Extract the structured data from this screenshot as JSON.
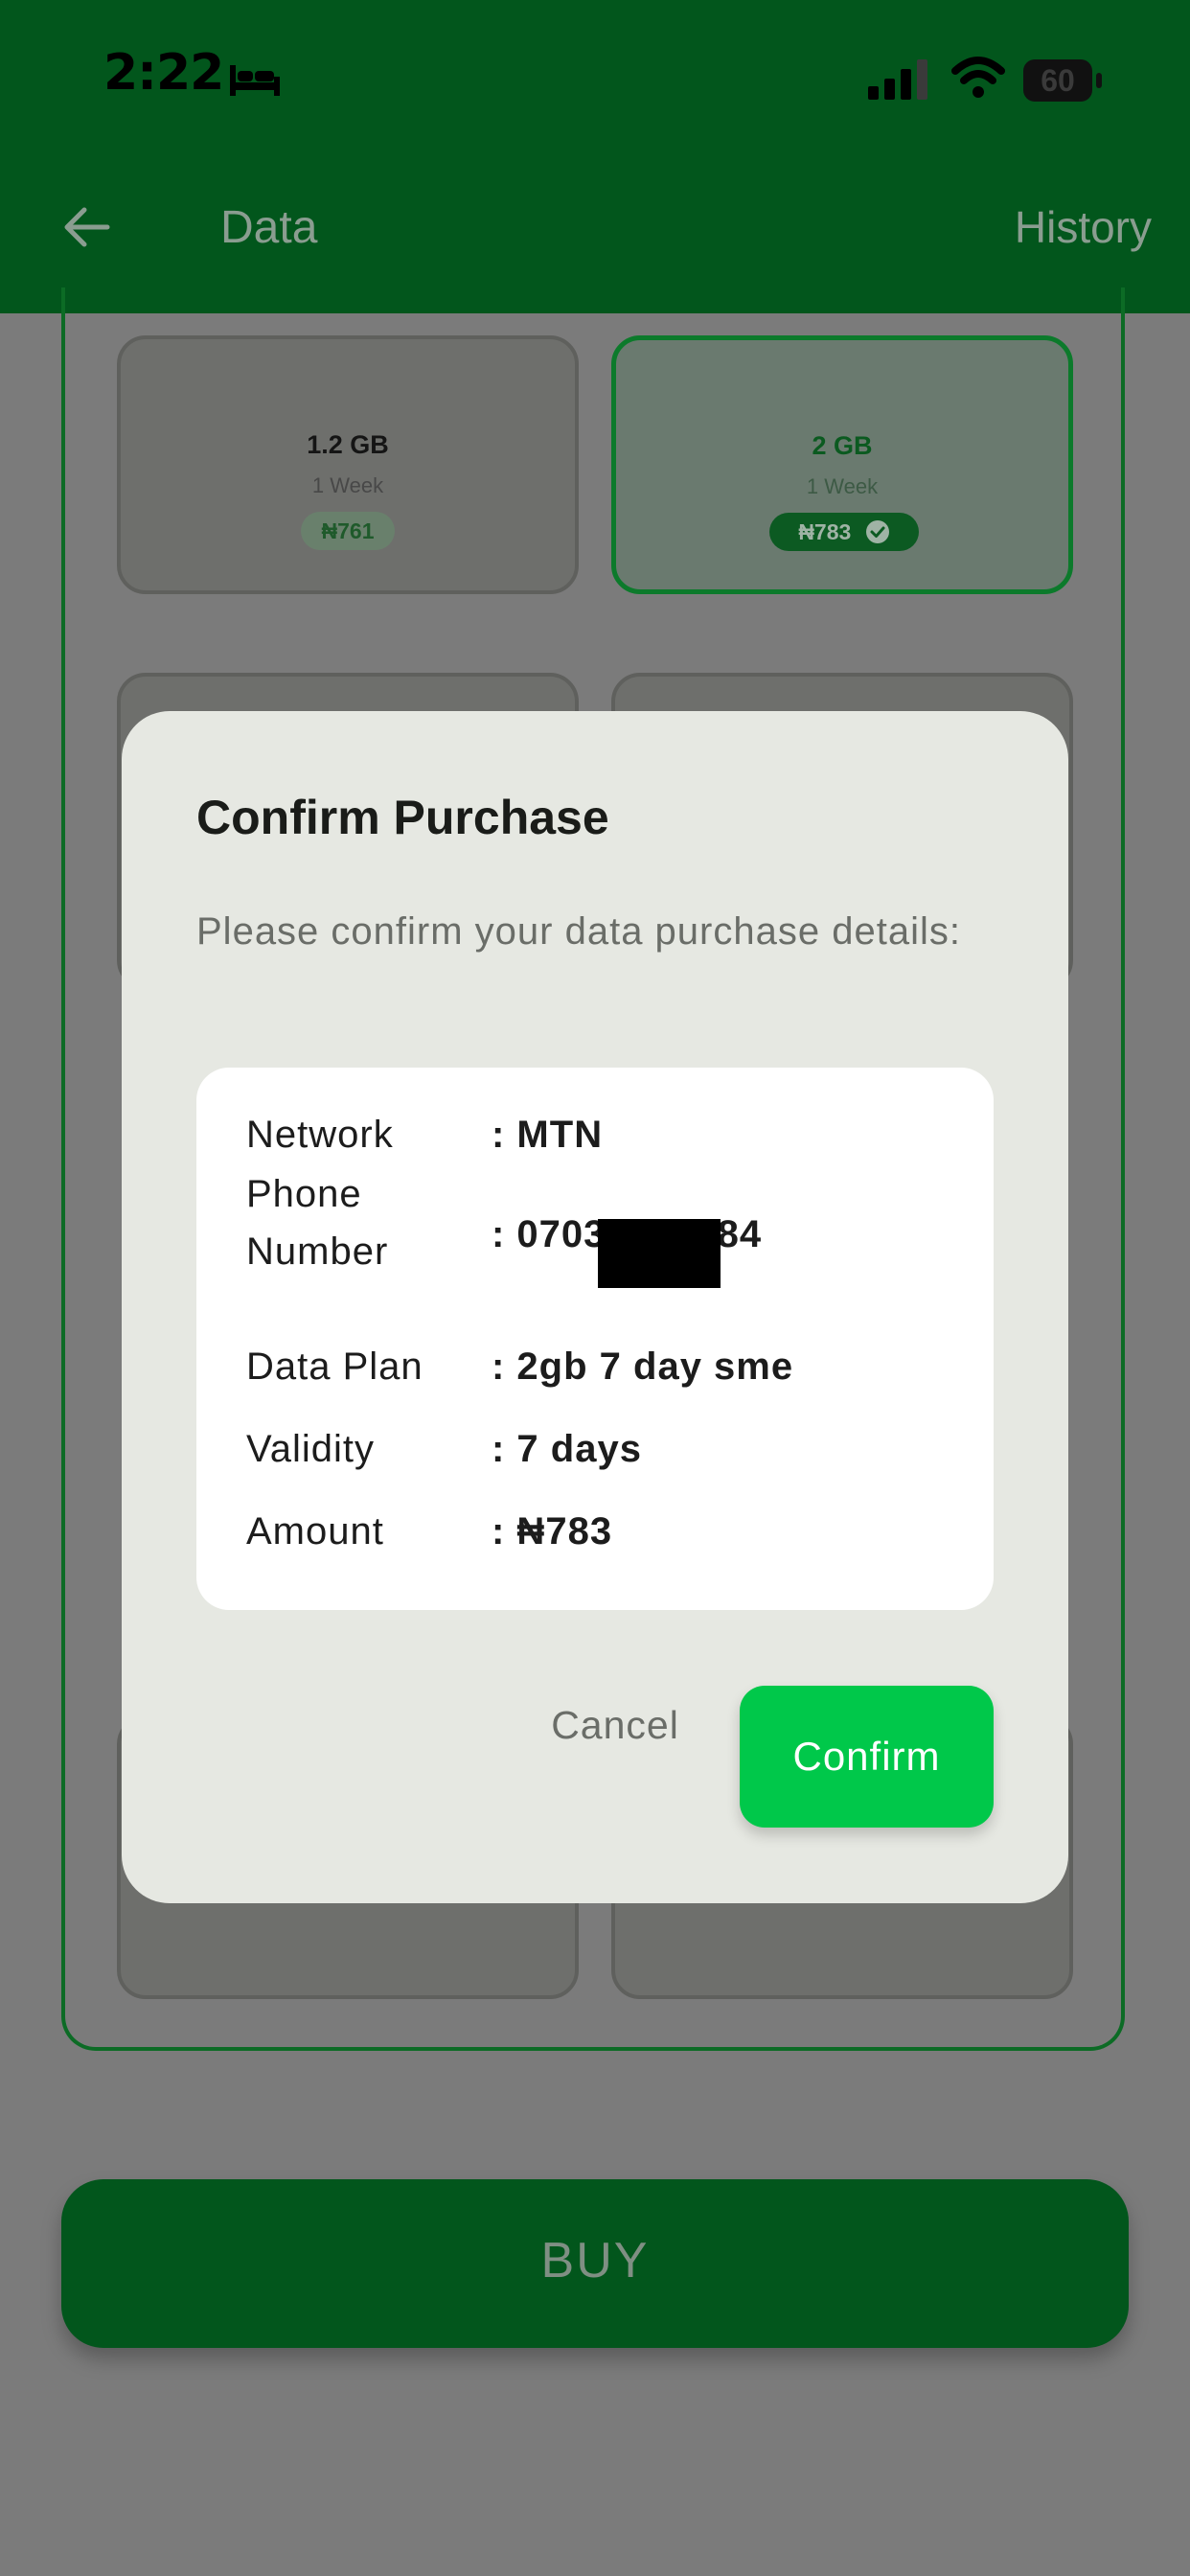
{
  "status_bar": {
    "time": "2:22",
    "battery": "60"
  },
  "header": {
    "title": "Data",
    "history_label": "History"
  },
  "plans": [
    {
      "size": "1.2 GB",
      "validity": "1 Week",
      "price": "₦761",
      "selected": false
    },
    {
      "size": "2 GB",
      "validity": "1 Week",
      "price": "₦783",
      "selected": true
    }
  ],
  "buy_label": "BUY",
  "dialog": {
    "title": "Confirm Purchase",
    "message": "Please confirm your data purchase details:",
    "details": {
      "network_label": "Network",
      "network_value": ": MTN",
      "phone_label": "Phone Number",
      "phone_value": ": 07034801584",
      "plan_label": "Data Plan",
      "plan_value": ": 2gb 7 day sme",
      "validity_label": "Validity",
      "validity_value": ": 7 days",
      "amount_label": "Amount",
      "amount_value": ": ₦783"
    },
    "cancel_label": "Cancel",
    "confirm_label": "Confirm"
  },
  "colors": {
    "header": "#02561c",
    "accent": "#00c84a",
    "overlay": "#7b7b7b"
  }
}
